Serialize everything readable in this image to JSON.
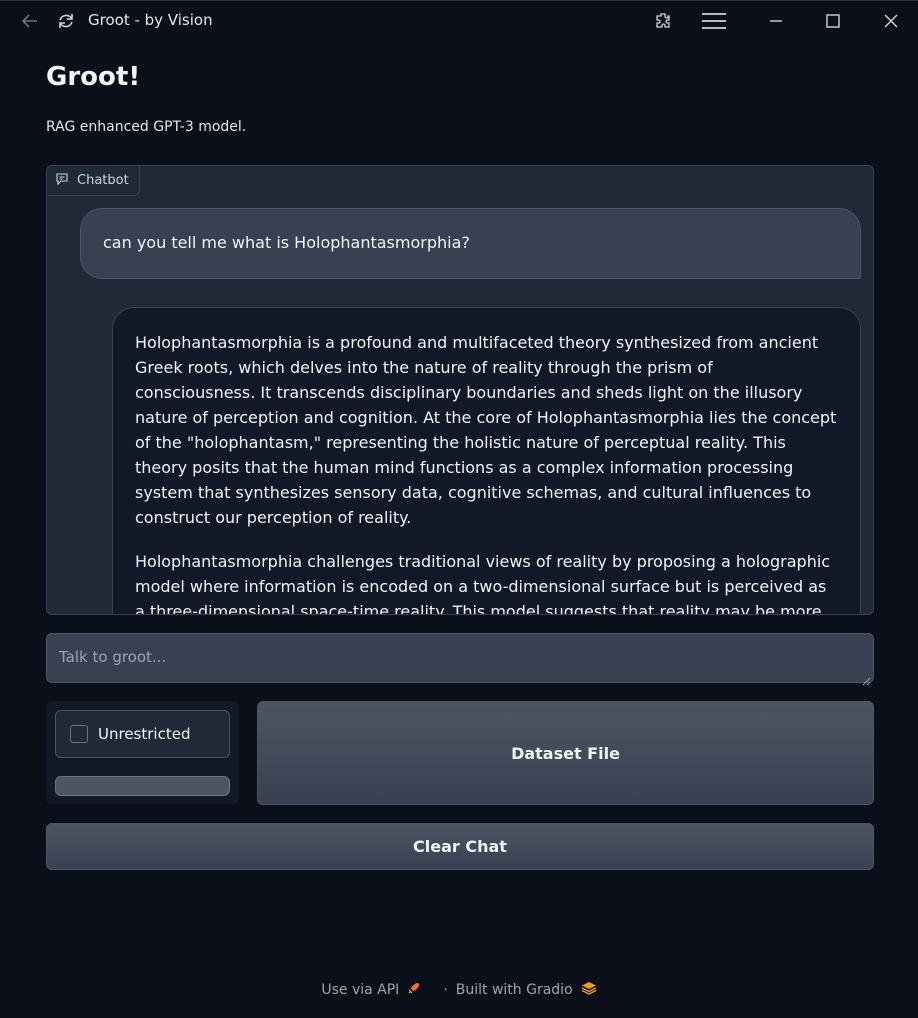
{
  "window": {
    "title": "Groot - by Vision",
    "icons": [
      "back-arrow-icon",
      "reload-icon",
      "extensions-icon",
      "menu-icon",
      "minimize-icon",
      "maximize-icon",
      "close-icon"
    ]
  },
  "header": {
    "title": "Groot!",
    "subtitle": "RAG enhanced GPT-3 model."
  },
  "chatbot": {
    "label": "Chatbot",
    "user_message": "can you tell me what is Holophantasmorphia?",
    "bot_paragraphs": [
      "Holophantasmorphia is a profound and multifaceted theory synthesized from ancient Greek roots, which delves into the nature of reality through the prism of consciousness. It transcends disciplinary boundaries and sheds light on the illusory nature of perception and cognition. At the core of Holophantasmorphia lies the concept of the \"holophantasm,\" representing the holistic nature of perceptual reality. This theory posits that the human mind functions as a complex information processing system that synthesizes sensory data, cognitive schemas, and cultural influences to construct our perception of reality.",
      "Holophantasmorphia challenges traditional views of reality by proposing a holographic model where information is encoded on a two-dimensional surface but is perceived as a three-dimensional space-time reality. This model suggests that reality may be more subjective and malleable than previously believed, opening up new avenues for"
    ]
  },
  "input": {
    "placeholder": "Talk to groot...",
    "value": ""
  },
  "options": {
    "checkbox_label": "Unrestricted",
    "checked": false
  },
  "buttons": {
    "dataset": "Dataset File",
    "clear": "Clear Chat"
  },
  "footer": {
    "api": "Use via API",
    "separator": "·",
    "built": "Built with Gradio"
  },
  "colors": {
    "background": "#0b0f19",
    "panel": "#1f2937",
    "bot_bubble": "#111827",
    "user_bubble": "#374151",
    "accent_rocket": "#f97316",
    "accent_gradio": "#f59e0b"
  }
}
